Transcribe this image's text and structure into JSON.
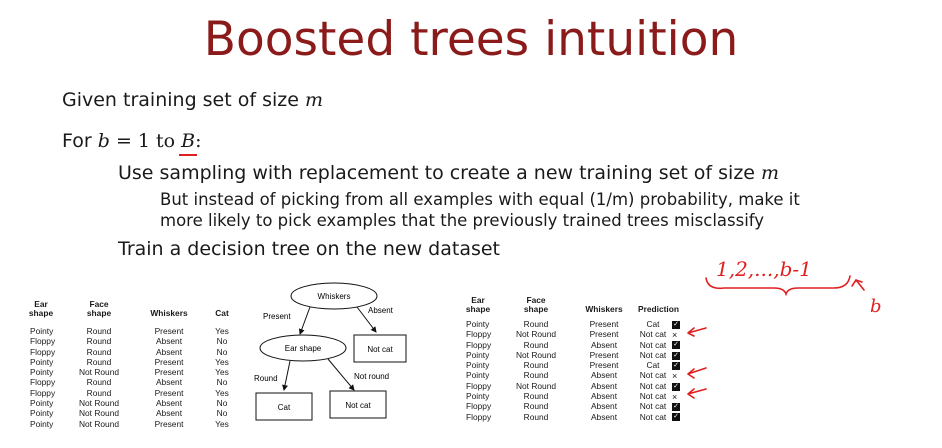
{
  "title": "Boosted trees intuition",
  "given": {
    "prefix": "Given training set of size ",
    "var": "m"
  },
  "for": {
    "label": "For ",
    "b": "b",
    "eq": " = 1 to ",
    "B": "B",
    "colon": ":"
  },
  "steps": {
    "sampling": {
      "text": "Use sampling with replacement to create a new training set of size ",
      "var": "m"
    },
    "instead_line1": "But instead of picking from all examples with equal (1/m) probability, make it",
    "instead_line2": "more likely to pick examples that the previously trained trees misclassify",
    "train": "Train a decision tree on the new dataset"
  },
  "left_table": {
    "headers": [
      {
        "line1": "Ear",
        "line2": "shape"
      },
      {
        "line1": "Face",
        "line2": "shape"
      },
      {
        "line1": "",
        "line2": "Whiskers"
      },
      {
        "line1": "",
        "line2": "Cat"
      }
    ],
    "rows": [
      [
        "Pointy",
        "Round",
        "Present",
        "Yes"
      ],
      [
        "Floppy",
        "Round",
        "Absent",
        "No"
      ],
      [
        "Floppy",
        "Round",
        "Absent",
        "No"
      ],
      [
        "Pointy",
        "Round",
        "Present",
        "Yes"
      ],
      [
        "Pointy",
        "Not Round",
        "Present",
        "Yes"
      ],
      [
        "Floppy",
        "Round",
        "Absent",
        "No"
      ],
      [
        "Floppy",
        "Round",
        "Present",
        "Yes"
      ],
      [
        "Pointy",
        "Not Round",
        "Absent",
        "No"
      ],
      [
        "Pointy",
        "Not Round",
        "Absent",
        "No"
      ],
      [
        "Pointy",
        "Not Round",
        "Present",
        "Yes"
      ]
    ]
  },
  "tree": {
    "root": "Whiskers",
    "edge_present": "Present",
    "edge_absent": "Absent",
    "ear_node": "Ear shape",
    "notcat_right": "Not cat",
    "edge_round": "Round",
    "edge_notround": "Not round",
    "leaf_cat": "Cat",
    "leaf_notcat": "Not cat"
  },
  "right_table": {
    "headers": [
      {
        "line1": "Ear",
        "line2": "shape"
      },
      {
        "line1": "Face",
        "line2": "shape"
      },
      {
        "line1": "",
        "line2": "Whiskers"
      },
      {
        "line1": "",
        "line2": "Prediction"
      }
    ],
    "rows": [
      {
        "ear": "Pointy",
        "face": "Round",
        "whiskers": "Present",
        "pred": "Cat",
        "mark": "check"
      },
      {
        "ear": "Floppy",
        "face": "Not Round",
        "whiskers": "Present",
        "pred": "Not cat",
        "mark": "x"
      },
      {
        "ear": "Floppy",
        "face": "Round",
        "whiskers": "Absent",
        "pred": "Not cat",
        "mark": "check"
      },
      {
        "ear": "Pointy",
        "face": "Not Round",
        "whiskers": "Present",
        "pred": "Not cat",
        "mark": "check"
      },
      {
        "ear": "Pointy",
        "face": "Round",
        "whiskers": "Present",
        "pred": "Cat",
        "mark": "check"
      },
      {
        "ear": "Pointy",
        "face": "Round",
        "whiskers": "Absent",
        "pred": "Not cat",
        "mark": "x"
      },
      {
        "ear": "Floppy",
        "face": "Not Round",
        "whiskers": "Absent",
        "pred": "Not cat",
        "mark": "check"
      },
      {
        "ear": "Pointy",
        "face": "Round",
        "whiskers": "Absent",
        "pred": "Not cat",
        "mark": "x"
      },
      {
        "ear": "Floppy",
        "face": "Round",
        "whiskers": "Absent",
        "pred": "Not cat",
        "mark": "check"
      },
      {
        "ear": "Floppy",
        "face": "Round",
        "whiskers": "Absent",
        "pred": "Not cat",
        "mark": "check"
      }
    ]
  },
  "annotation": {
    "sequence": "1,2,...,b-1",
    "b": "b"
  },
  "colors": {
    "title": "#8b1a1a",
    "annotation": "#e02020"
  },
  "icons": {
    "check": "check-icon",
    "x": "x-mark-icon",
    "arrow": "red-arrow-icon"
  }
}
